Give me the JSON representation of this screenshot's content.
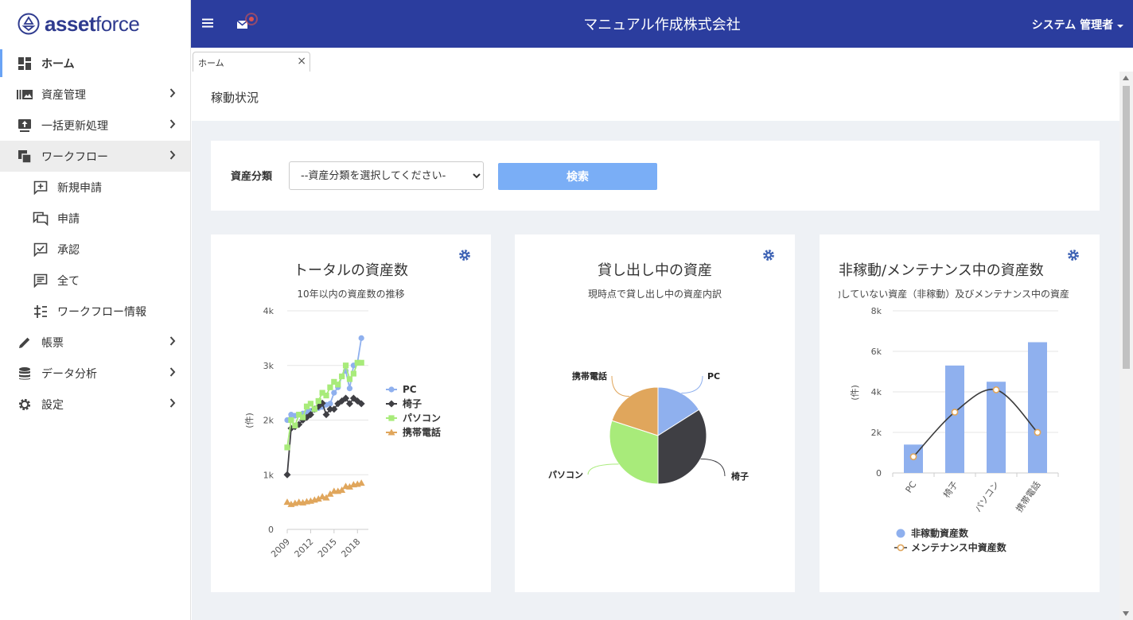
{
  "app": {
    "logo_text_bold": "asset",
    "logo_text_light": "force",
    "company_name": "マニュアル作成株式会社",
    "user_menu": "システム 管理者"
  },
  "sidebar": {
    "items": [
      {
        "label": "ホーム",
        "icon": "dashboard-icon"
      },
      {
        "label": "資産管理",
        "icon": "asset-library-icon"
      },
      {
        "label": "一括更新処理",
        "icon": "upload-icon"
      },
      {
        "label": "ワークフロー",
        "icon": "workflow-icon"
      },
      {
        "label": "帳票",
        "icon": "pencil-icon"
      },
      {
        "label": "データ分析",
        "icon": "database-icon"
      },
      {
        "label": "設定",
        "icon": "gear-icon"
      }
    ],
    "workflow_sub": [
      {
        "label": "新規申請",
        "icon": "add-comment-icon"
      },
      {
        "label": "申請",
        "icon": "chat-bubbles-icon"
      },
      {
        "label": "承認",
        "icon": "approve-check-icon"
      },
      {
        "label": "全て",
        "icon": "comment-list-icon"
      },
      {
        "label": "ワークフロー情報",
        "icon": "flow-info-icon"
      }
    ]
  },
  "tabs": [
    {
      "label": "ホーム"
    }
  ],
  "page": {
    "title": "稼動状況"
  },
  "filter": {
    "label": "資産分類",
    "select_value": "--資産分類を選択してください-",
    "search_label": "検索"
  },
  "colors": {
    "header": "#2b3d9e",
    "pc": "#8fb0ee",
    "chair": "#3f3f44",
    "computer": "#a8eb7a",
    "phone": "#e0a65c"
  },
  "chart_data": [
    {
      "type": "line",
      "title": "トータルの資産数",
      "subtitle": "10年以内の資産数の推移",
      "ylabel": "(件)",
      "ylim": [
        0,
        4000
      ],
      "yticks": [
        "0",
        "1k",
        "2k",
        "3k",
        "4k"
      ],
      "xticks": [
        "2009",
        "2012",
        "2015",
        "2018"
      ],
      "x": [
        2009,
        2009.5,
        2010,
        2010.5,
        2011,
        2011.5,
        2012,
        2012.5,
        2013,
        2013.5,
        2014,
        2014.5,
        2015,
        2015.5,
        2016,
        2016.5,
        2017,
        2017.5,
        2018,
        2018.5
      ],
      "series": [
        {
          "name": "PC",
          "marker": "circle",
          "values": [
            2000,
            2100,
            2080,
            2100,
            2120,
            2150,
            2170,
            2190,
            2220,
            2240,
            2280,
            2300,
            2500,
            2600,
            2800,
            2900,
            2580,
            3000,
            3050,
            3500
          ]
        },
        {
          "name": "椅子",
          "marker": "diamond",
          "values": [
            1000,
            1850,
            1880,
            1920,
            2000,
            2050,
            2100,
            2200,
            2250,
            2310,
            2100,
            2200,
            2200,
            2300,
            2350,
            2400,
            2300,
            2400,
            2350,
            2300
          ]
        },
        {
          "name": "パソコン",
          "marker": "square",
          "values": [
            1500,
            2000,
            1900,
            2100,
            2050,
            2250,
            2300,
            2200,
            2350,
            2500,
            2450,
            2600,
            2700,
            2650,
            2800,
            3000,
            2750,
            2850,
            3050,
            3050
          ]
        },
        {
          "name": "携帯電話",
          "marker": "triangle",
          "values": [
            500,
            460,
            480,
            500,
            490,
            510,
            520,
            540,
            560,
            600,
            580,
            650,
            700,
            700,
            720,
            790,
            780,
            820,
            830,
            850
          ]
        }
      ]
    },
    {
      "type": "pie",
      "title": "貸し出し中の資産",
      "subtitle": "現時点で貸し出し中の資産内訳",
      "slices": [
        {
          "name": "PC",
          "value": 16
        },
        {
          "name": "椅子",
          "value": 34
        },
        {
          "name": "パソコン",
          "value": 30
        },
        {
          "name": "携帯電話",
          "value": 20
        }
      ]
    },
    {
      "type": "bar",
      "title": "非稼動/メンテナンス中の資産数",
      "subtitle": "稼動していない資産（非稼動）及びメンテナンス中の資産",
      "ylabel": "(件)",
      "ylim": [
        0,
        8000
      ],
      "yticks": [
        "0",
        "2k",
        "4k",
        "6k",
        "8k"
      ],
      "categories": [
        "PC",
        "椅子",
        "パソコン",
        "携帯電話"
      ],
      "series": [
        {
          "name": "非稼動資産数",
          "type": "bar",
          "values": [
            1400,
            5300,
            4500,
            6450
          ]
        },
        {
          "name": "メンテナンス中資産数",
          "type": "line",
          "values": [
            800,
            3000,
            4100,
            2000
          ]
        }
      ]
    }
  ]
}
